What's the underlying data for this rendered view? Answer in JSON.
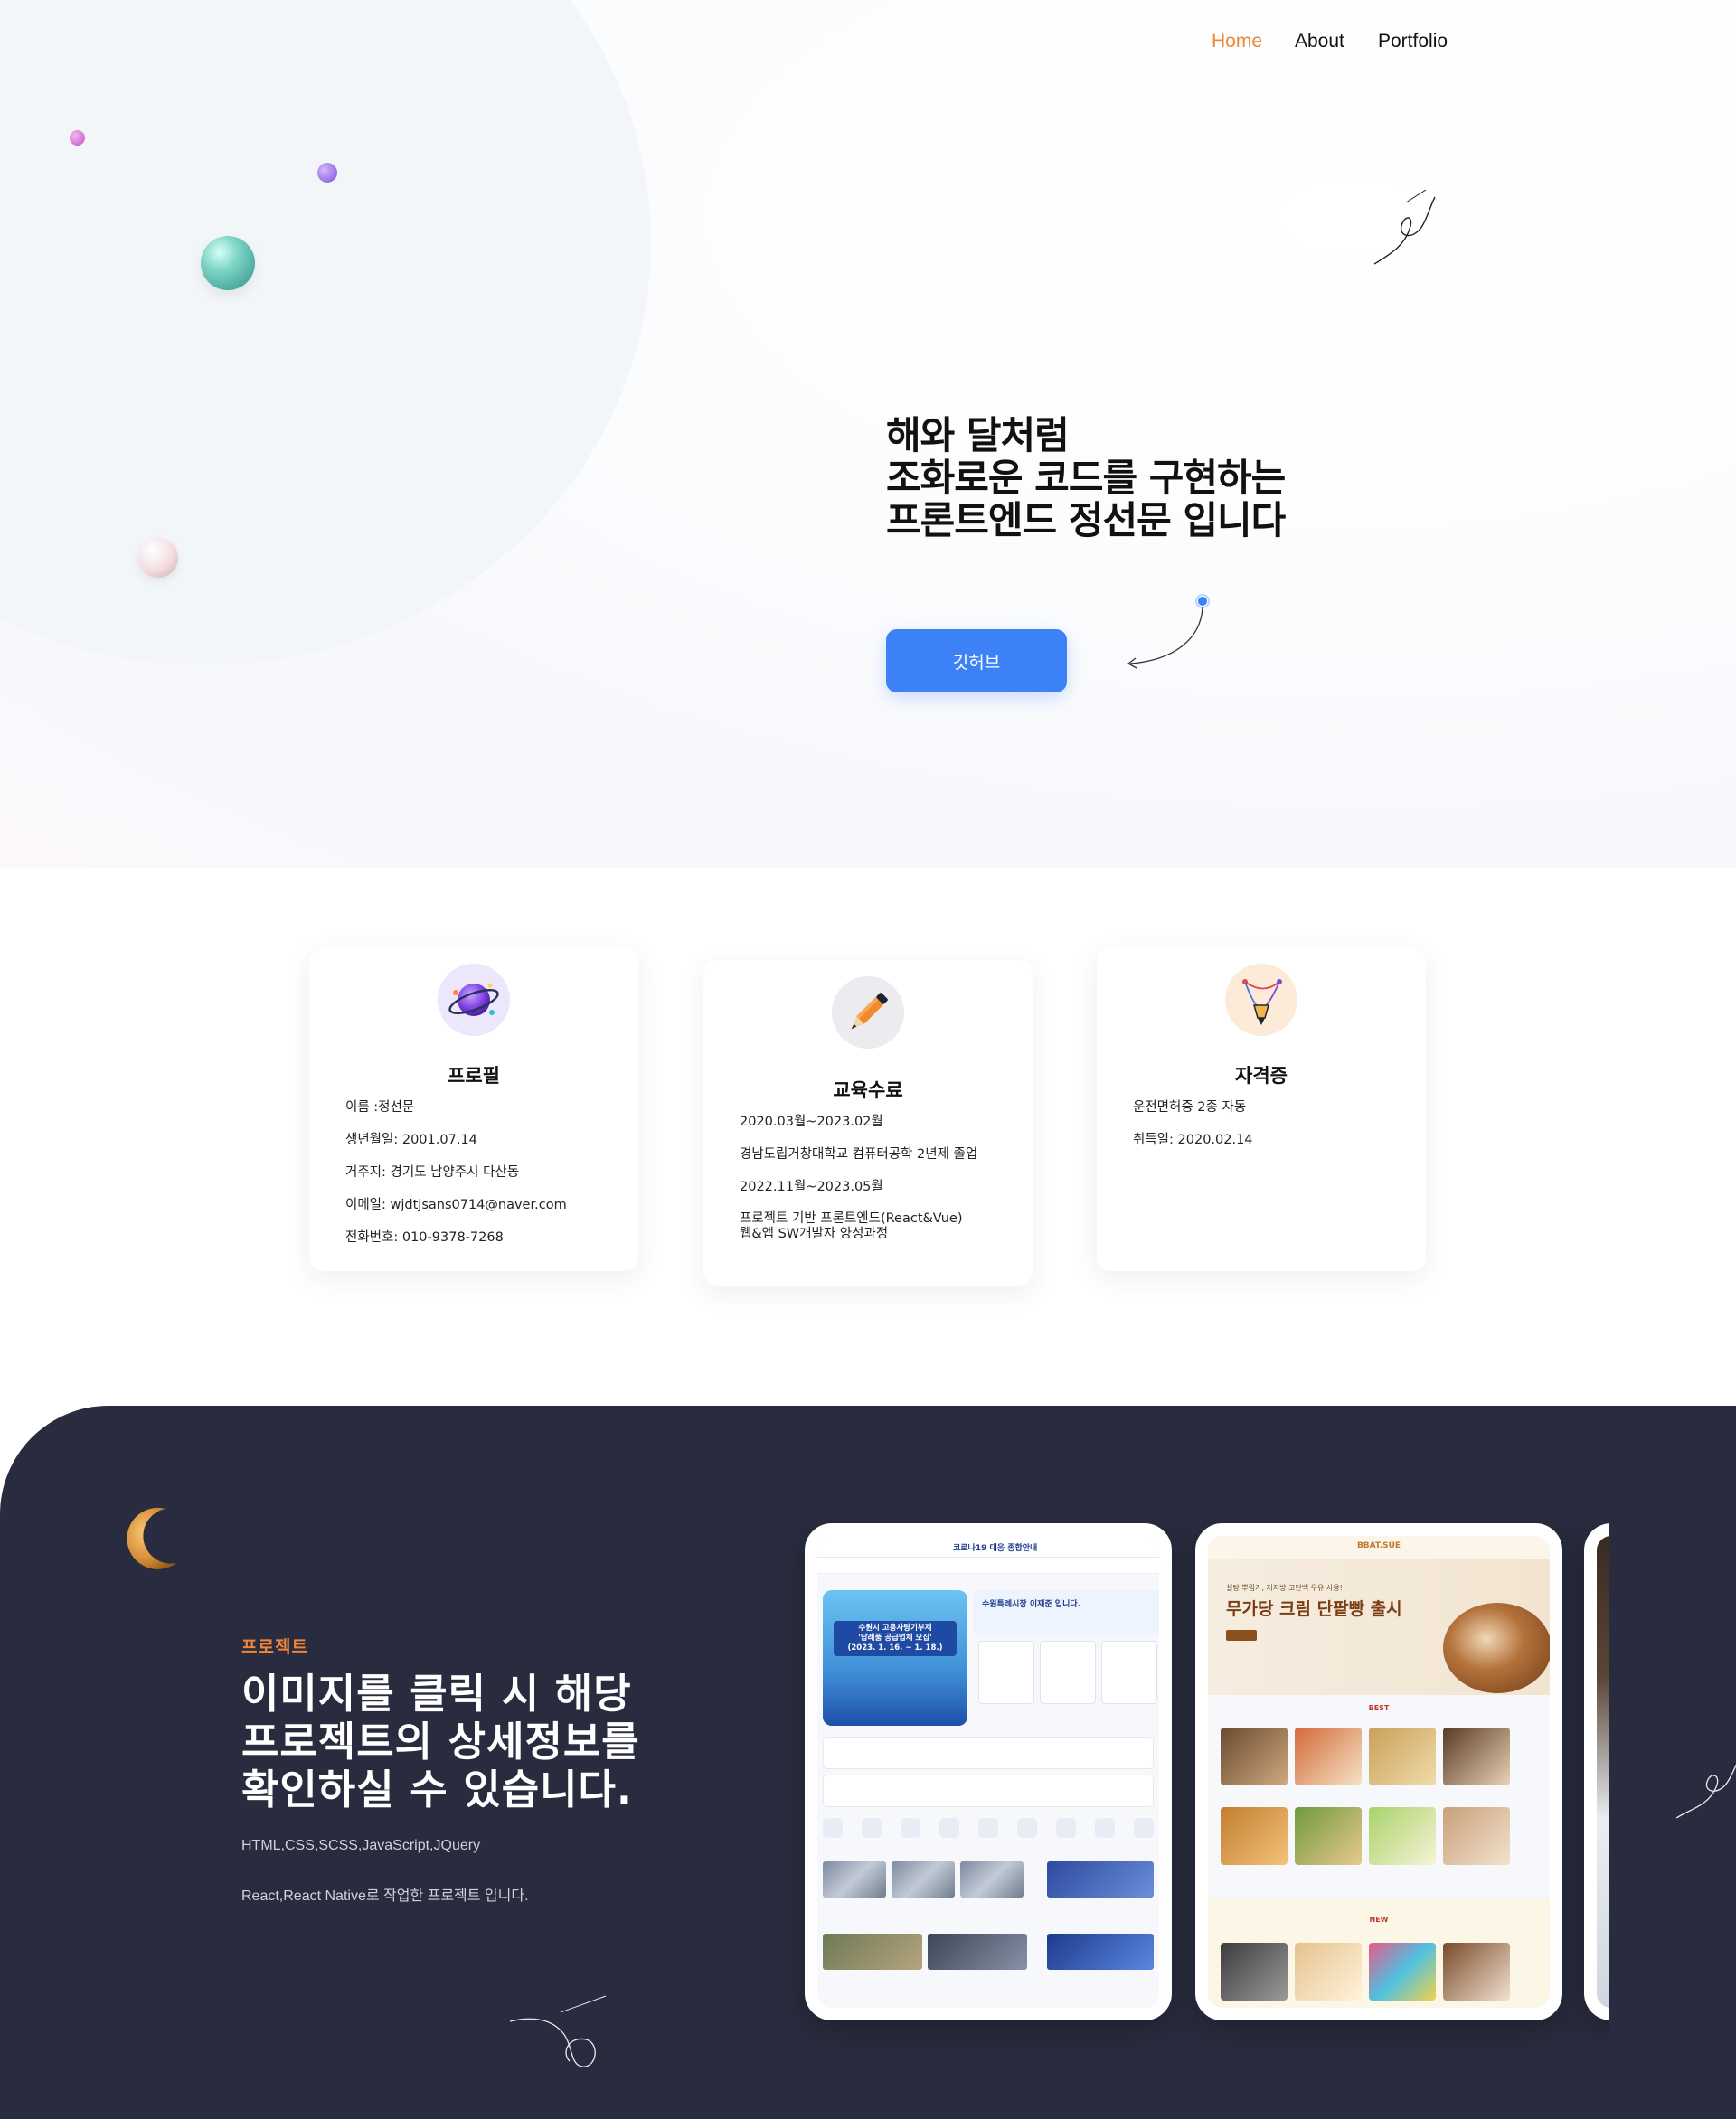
{
  "nav": {
    "home": "Home",
    "about": "About",
    "portfolio": "Portfolio"
  },
  "hero": {
    "line1": "해와 달처럼",
    "line2": "조화로운 코드를 구현하는",
    "line3": "프론트엔드 정선문 입니다",
    "github_button": "깃허브"
  },
  "cards": {
    "profile": {
      "title": "프로필",
      "lines": [
        "이름 :정선문",
        "생년월일: 2001.07.14",
        "거주지: 경기도 남양주시 다산동",
        "이메일: wjdtjsans0714@naver.com",
        "전화번호: 010-9378-7268"
      ]
    },
    "education": {
      "title": "교육수료",
      "lines": [
        "2020.03월~2023.02월",
        "경남도립거창대학교 컴퓨터공학 2년제 졸업",
        "2022.11월~2023.05월",
        "프로젝트 기반 프론트엔드(React&Vue)",
        "웹&앱 SW개발자 양성과정"
      ]
    },
    "certificate": {
      "title": "자격증",
      "lines": [
        "운전면허증 2종 자동",
        "취득일: 2020.02.14"
      ]
    }
  },
  "projects": {
    "eyebrow": "프로젝트",
    "title_line1": "이미지를 클릭 시 해당",
    "title_line2": "프로젝트의 상세정보를",
    "title_line3": "확인하실 수 있습니다.",
    "desc_line1": "HTML,CSS,SCSS,JavaScript,JQuery",
    "desc_line2": "React,React Native로 작업한 프로젝트 입니다.",
    "items": [
      {
        "logo": "코로나19 대응 종합안내",
        "side_title": "수원특례시장 이재준 입니다.",
        "banner_line1": "수원시 고용사랑기부제",
        "banner_line2": "'답례품 공급업체 모집'",
        "banner_line3": "(2023. 1. 16. ~ 1. 18.)"
      },
      {
        "logo": "BBAT.SUE",
        "hero_small": "설탕 뿌림가, 저지방 고단백 우유 사용!",
        "hero_big": "무가당 크림 단팥빵 출시",
        "best_label": "BEST",
        "new_label": "NEW"
      }
    ]
  },
  "colors": {
    "accent_orange": "#f0843a",
    "primary_blue": "#3c82f6",
    "dark_bg": "#282c3e"
  },
  "icons": [
    "planet-icon",
    "pencil-icon",
    "pen-tool-icon",
    "moon-icon"
  ]
}
